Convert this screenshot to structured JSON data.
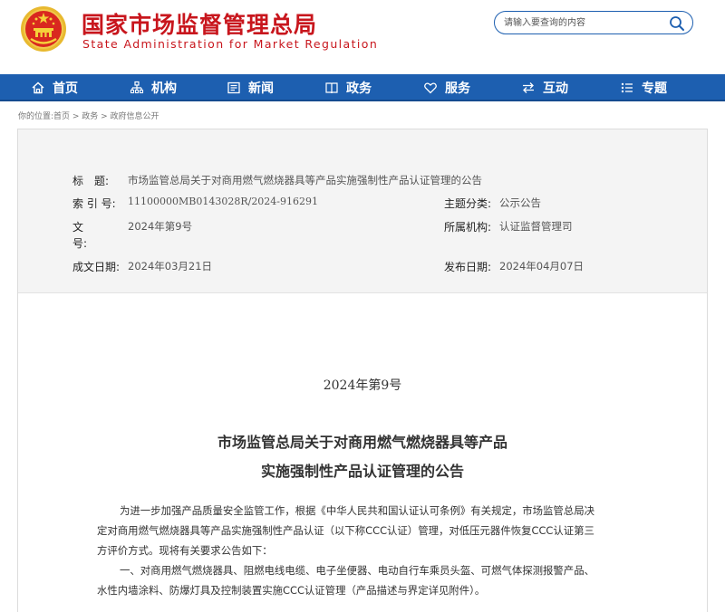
{
  "header": {
    "site_title": "国家市场监督管理总局",
    "site_subtitle": "State Administration for Market Regulation",
    "search_placeholder": "请输入要查询的内容",
    "brand_color": "#c8161d"
  },
  "nav": {
    "color": "#1d5fb0",
    "items": [
      {
        "label": "首页",
        "icon": "home-icon"
      },
      {
        "label": "机构",
        "icon": "org-chart-icon"
      },
      {
        "label": "新闻",
        "icon": "news-icon"
      },
      {
        "label": "政务",
        "icon": "book-icon"
      },
      {
        "label": "服务",
        "icon": "heart-icon"
      },
      {
        "label": "互动",
        "icon": "exchange-icon"
      },
      {
        "label": "专题",
        "icon": "list-icon"
      }
    ]
  },
  "breadcrumb": "你的位置:首页 > 政务 > 政府信息公开",
  "meta": {
    "title_label": "标　题:",
    "title_value": "市场监管总局关于对商用燃气燃烧器具等产品实施强制性产品认证管理的公告",
    "index_label": "索 引 号:",
    "index_value": "11100000MB0143028R/2024-916291",
    "category_label": "主题分类:",
    "category_value": "公示公告",
    "docno_label_1": "文",
    "docno_label_2": "号:",
    "docno_value": "2024年第9号",
    "org_label": "所属机构:",
    "org_value": "认证监督管理司",
    "written_label": "成文日期:",
    "written_value": "2024年03月21日",
    "published_label": "发布日期:",
    "published_value": "2024年04月07日"
  },
  "document": {
    "number": "2024年第9号",
    "title_line1": "市场监管总局关于对商用燃气燃烧器具等产品",
    "title_line2": "实施强制性产品认证管理的公告",
    "para1_line1": "为进一步加强产品质量安全监管工作，根据《中华人民共和国认证认可条例》有关规定，市场监管总局决",
    "para1_line2": "定对商用燃气燃烧器具等产品实施强制性产品认证（以下称CCC认证）管理，对低压元器件恢复CCC认证第三",
    "para1_line3": "方评价方式。现将有关要求公告如下：",
    "para2_line1": "一、对商用燃气燃烧器具、阻燃电线电缆、电子坐便器、电动自行车乘员头盔、可燃气体探测报警产品、",
    "para2_line2": "水性内墙涂料、防爆灯具及控制装置实施CCC认证管理（产品描述与界定详见附件）。"
  }
}
